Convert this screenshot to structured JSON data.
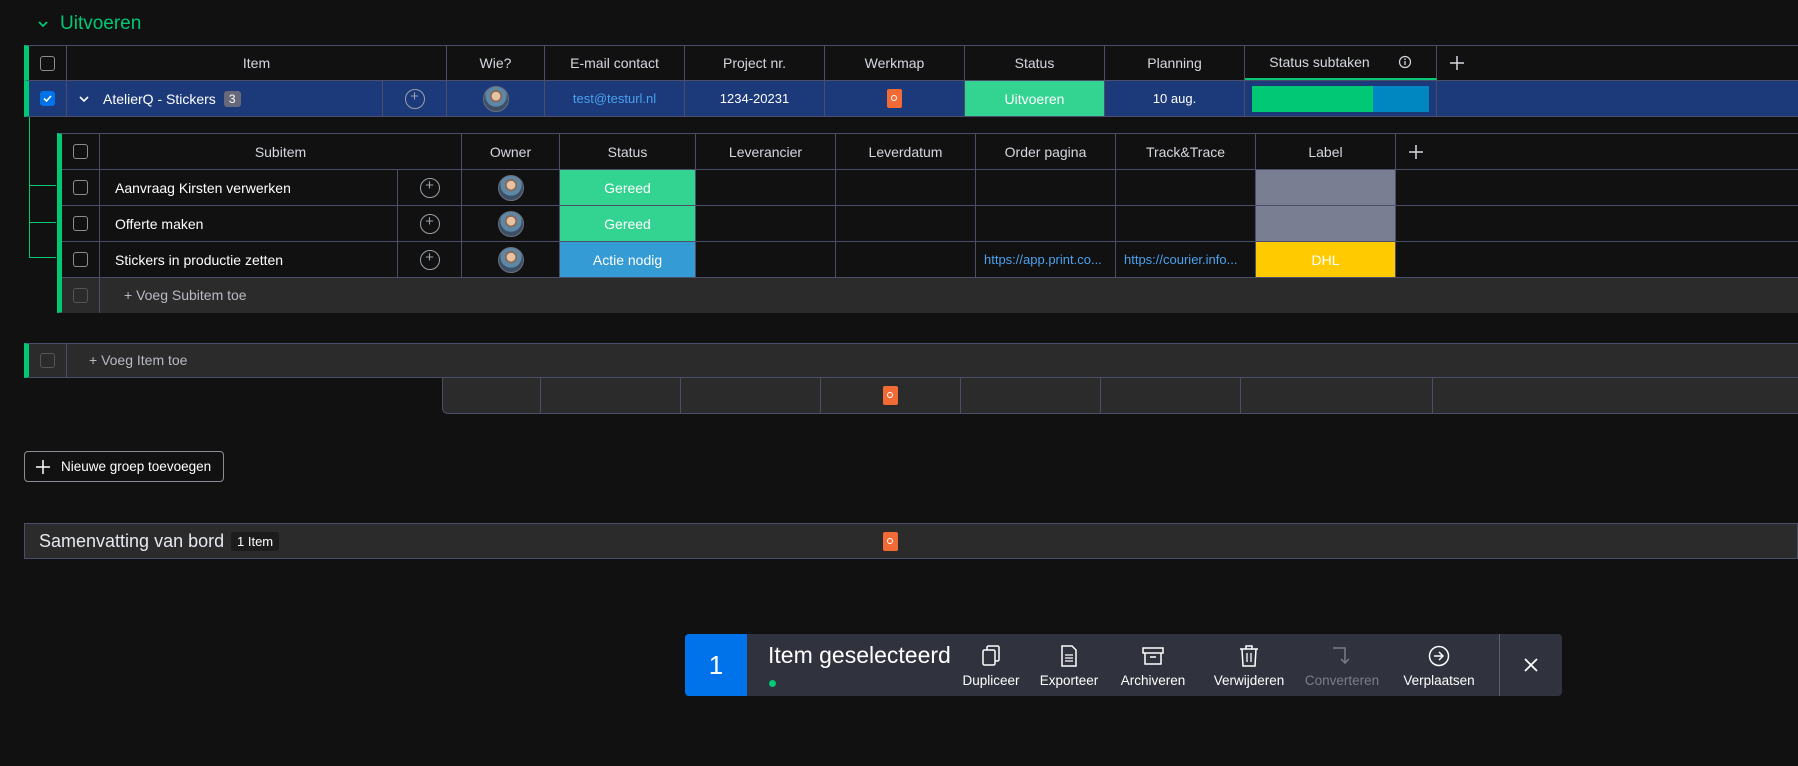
{
  "group": {
    "title": "Uitvoeren",
    "color": "#00c875",
    "columns": [
      "Item",
      "Wie?",
      "E-mail contact",
      "Project nr.",
      "Werkmap",
      "Status",
      "Planning",
      "Status subtaken"
    ],
    "item": {
      "name": "AtelierQ - Stickers",
      "subitem_count": "3",
      "email": "test@testurl.nl",
      "project_nr": "1234-20231",
      "status": "Uitvoeren",
      "status_color": "#33d391",
      "planning": "10 aug.",
      "progress": [
        {
          "fraction": 0.68,
          "color": "#00c875"
        },
        {
          "fraction": 0.32,
          "color": "#0086c0"
        }
      ]
    },
    "add_item": "+ Voeg Item toe"
  },
  "subitems": {
    "columns": [
      "Subitem",
      "Owner",
      "Status",
      "Leverancier",
      "Leverdatum",
      "Order pagina",
      "Track&Trace",
      "Label"
    ],
    "rows": [
      {
        "name": "Aanvraag Kirsten verwerken",
        "status": "Gereed",
        "status_color": "#33d391",
        "order": "",
        "track": "",
        "label": "",
        "label_color": "#797e93"
      },
      {
        "name": "Offerte maken",
        "status": "Gereed",
        "status_color": "#33d391",
        "order": "",
        "track": "",
        "label": "",
        "label_color": "#797e93"
      },
      {
        "name": "Stickers in productie zetten",
        "status": "Actie nodig",
        "status_color": "#349bd5",
        "order": "https://app.print.co...",
        "track": "https://courier.info...",
        "label": "DHL",
        "label_color": "#ffcb00"
      }
    ],
    "add_subitem": "+ Voeg Subitem toe"
  },
  "new_group_button": "Nieuwe groep toevoegen",
  "summary": {
    "title": "Samenvatting van bord",
    "badge": "1 Item"
  },
  "selection_bar": {
    "count": "1",
    "label": "Item geselecteerd",
    "actions": [
      {
        "label": "Dupliceer",
        "icon": "duplicate-icon"
      },
      {
        "label": "Exporteer",
        "icon": "export-icon"
      },
      {
        "label": "Archiveren",
        "icon": "archive-icon"
      },
      {
        "label": "Verwijderen",
        "icon": "trash-icon"
      },
      {
        "label": "Converteren",
        "icon": "convert-icon"
      },
      {
        "label": "Verplaatsen",
        "icon": "move-icon"
      }
    ]
  }
}
